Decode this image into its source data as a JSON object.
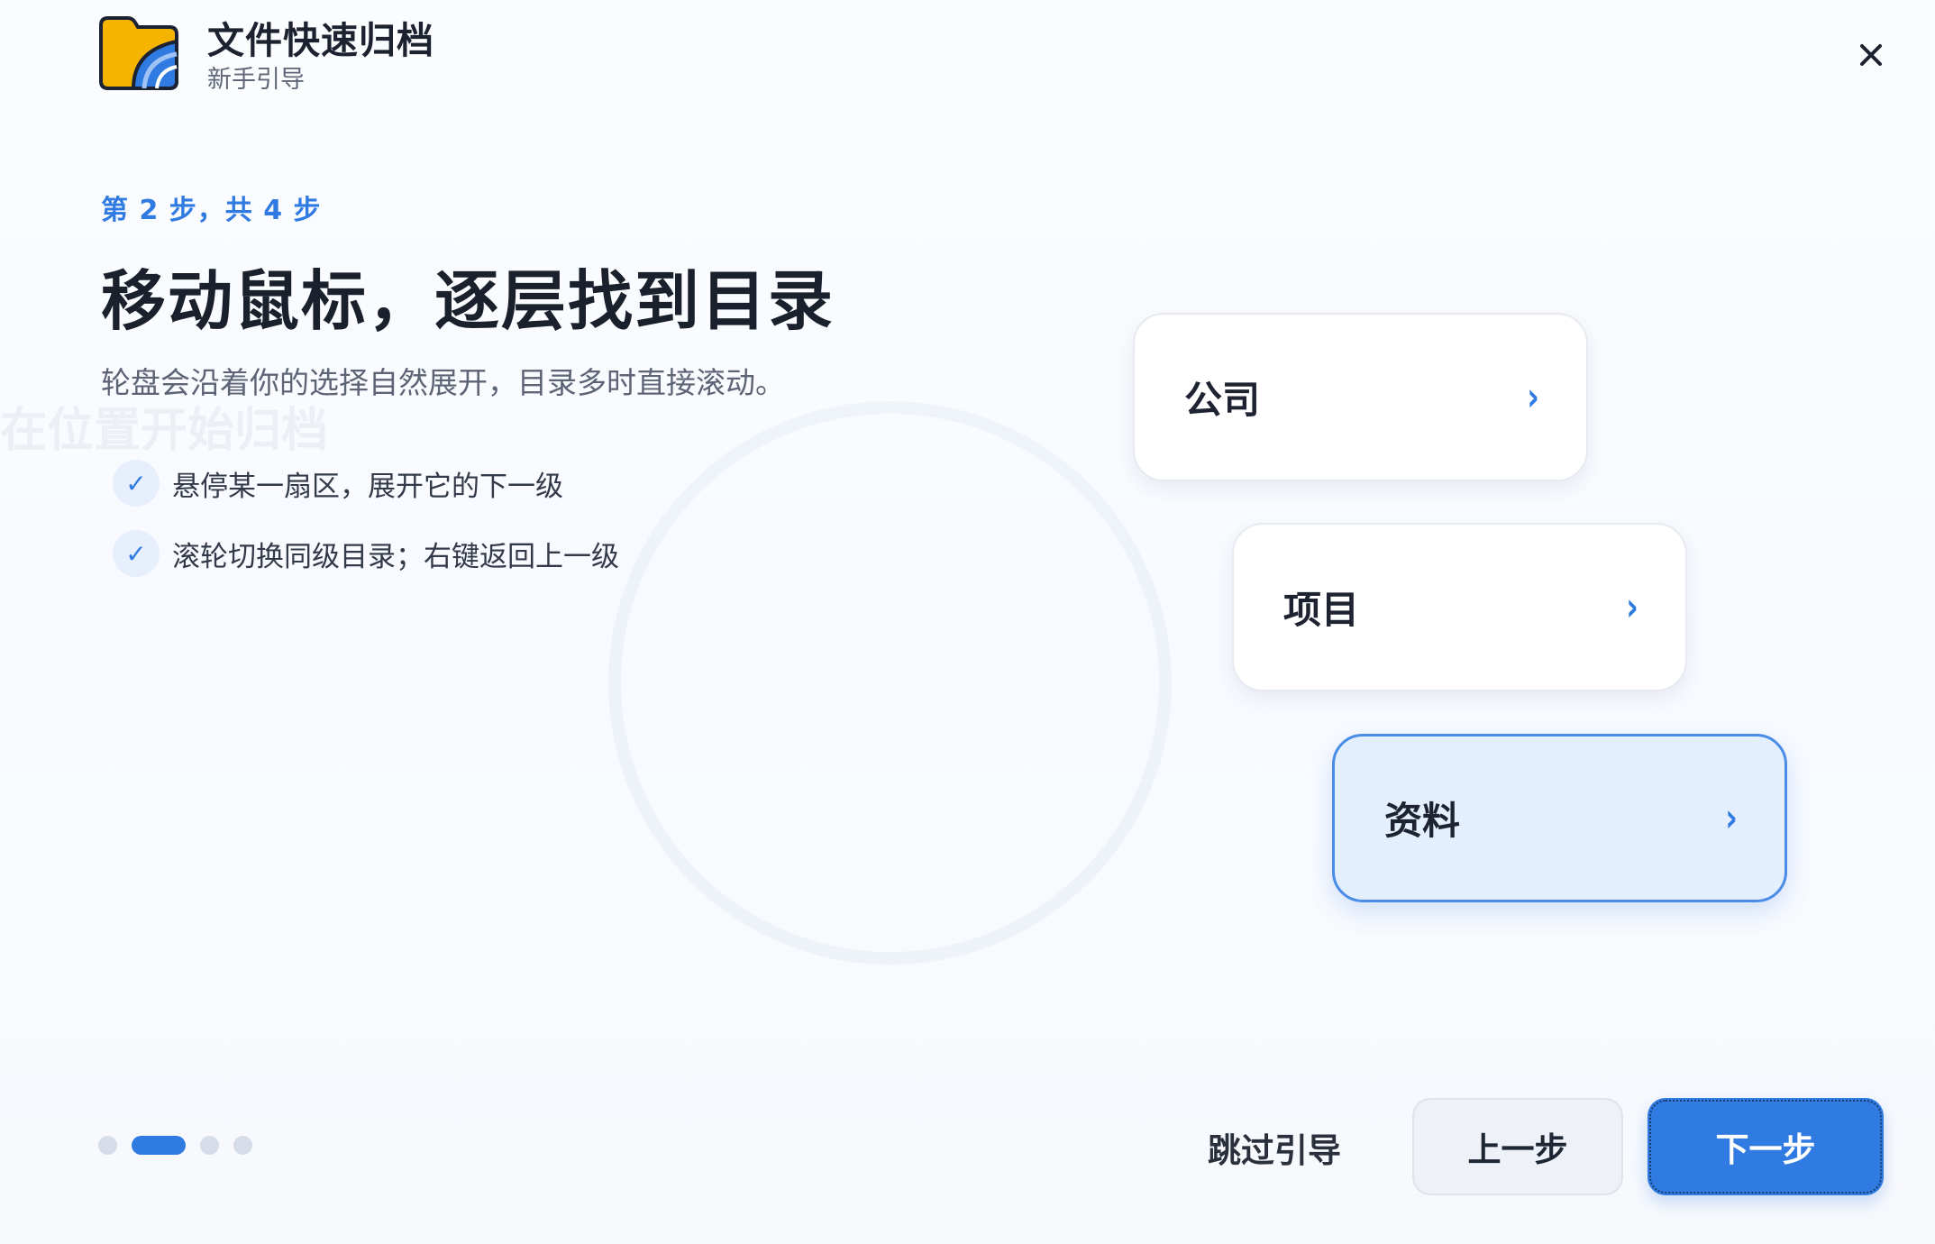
{
  "header": {
    "title": "文件快速归档",
    "subtitle": "新手引导",
    "logo_icon": "folder-icon",
    "close_icon": "close-icon"
  },
  "content": {
    "step_indicator": "第 2 步，共 4 步",
    "current_step": 2,
    "total_steps": 4,
    "heading": "移动鼠标，逐层找到目录",
    "description": "轮盘会沿着你的选择自然展开，目录多时直接滚动。",
    "bullets": [
      "悬停某一扇区，展开它的下一级",
      "滚轮切换同级目录；右键返回上一级"
    ]
  },
  "demo": {
    "cards": [
      {
        "label": "公司",
        "icon": "chevron-right-icon",
        "selected": false
      },
      {
        "label": "项目",
        "icon": "chevron-right-icon",
        "selected": false
      },
      {
        "label": "资料",
        "icon": "chevron-right-icon",
        "selected": true
      }
    ]
  },
  "footer": {
    "skip_label": "跳过引导",
    "prev_label": "上一步",
    "next_label": "下一步"
  },
  "colors": {
    "accent": "#2f7be1",
    "selected_card_bg": "#e4effe",
    "page_bg": "#f7f9fc"
  }
}
